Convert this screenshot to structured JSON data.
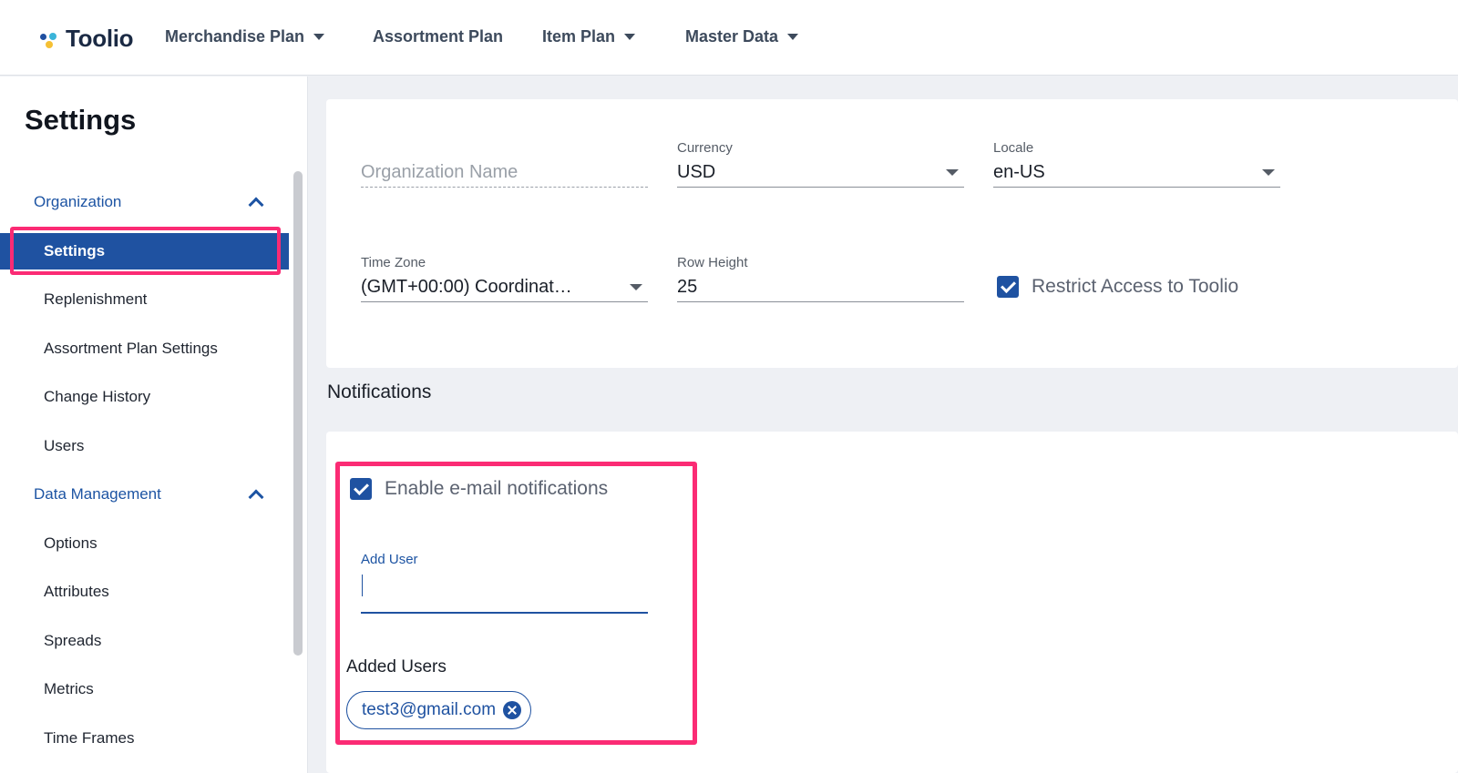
{
  "app": {
    "name": "Toolio"
  },
  "nav": {
    "items": [
      {
        "label": "Merchandise Plan",
        "has_dropdown": true
      },
      {
        "label": "Assortment Plan",
        "has_dropdown": false
      },
      {
        "label": "Item Plan",
        "has_dropdown": true
      },
      {
        "label": "Master Data",
        "has_dropdown": true
      }
    ]
  },
  "sidebar": {
    "title": "Settings",
    "groups": [
      {
        "label": "Organization",
        "expanded": true,
        "items": [
          {
            "label": "Settings",
            "active": true
          },
          {
            "label": "Replenishment"
          },
          {
            "label": "Assortment Plan Settings"
          },
          {
            "label": "Change History"
          },
          {
            "label": "Users"
          }
        ]
      },
      {
        "label": "Data Management",
        "expanded": true,
        "items": [
          {
            "label": "Options"
          },
          {
            "label": "Attributes"
          },
          {
            "label": "Spreads"
          },
          {
            "label": "Metrics"
          },
          {
            "label": "Time Frames"
          }
        ]
      }
    ]
  },
  "org_settings": {
    "org_name_placeholder": "Organization Name",
    "currency": {
      "label": "Currency",
      "value": "USD"
    },
    "locale": {
      "label": "Locale",
      "value": "en-US"
    },
    "time_zone": {
      "label": "Time Zone",
      "value": "(GMT+00:00) Coordinat…"
    },
    "row_height": {
      "label": "Row Height",
      "value": "25"
    },
    "restrict_access": {
      "label": "Restrict Access to Toolio",
      "checked": true
    }
  },
  "notifications": {
    "section_title": "Notifications",
    "enable_email": {
      "label": "Enable e-mail notifications",
      "checked": true
    },
    "add_user": {
      "label": "Add User",
      "value": ""
    },
    "added_users_label": "Added Users",
    "added_users": [
      "test3@gmail.com"
    ]
  },
  "colors": {
    "accent": "#1f52a1",
    "highlight": "#fb2b74"
  }
}
